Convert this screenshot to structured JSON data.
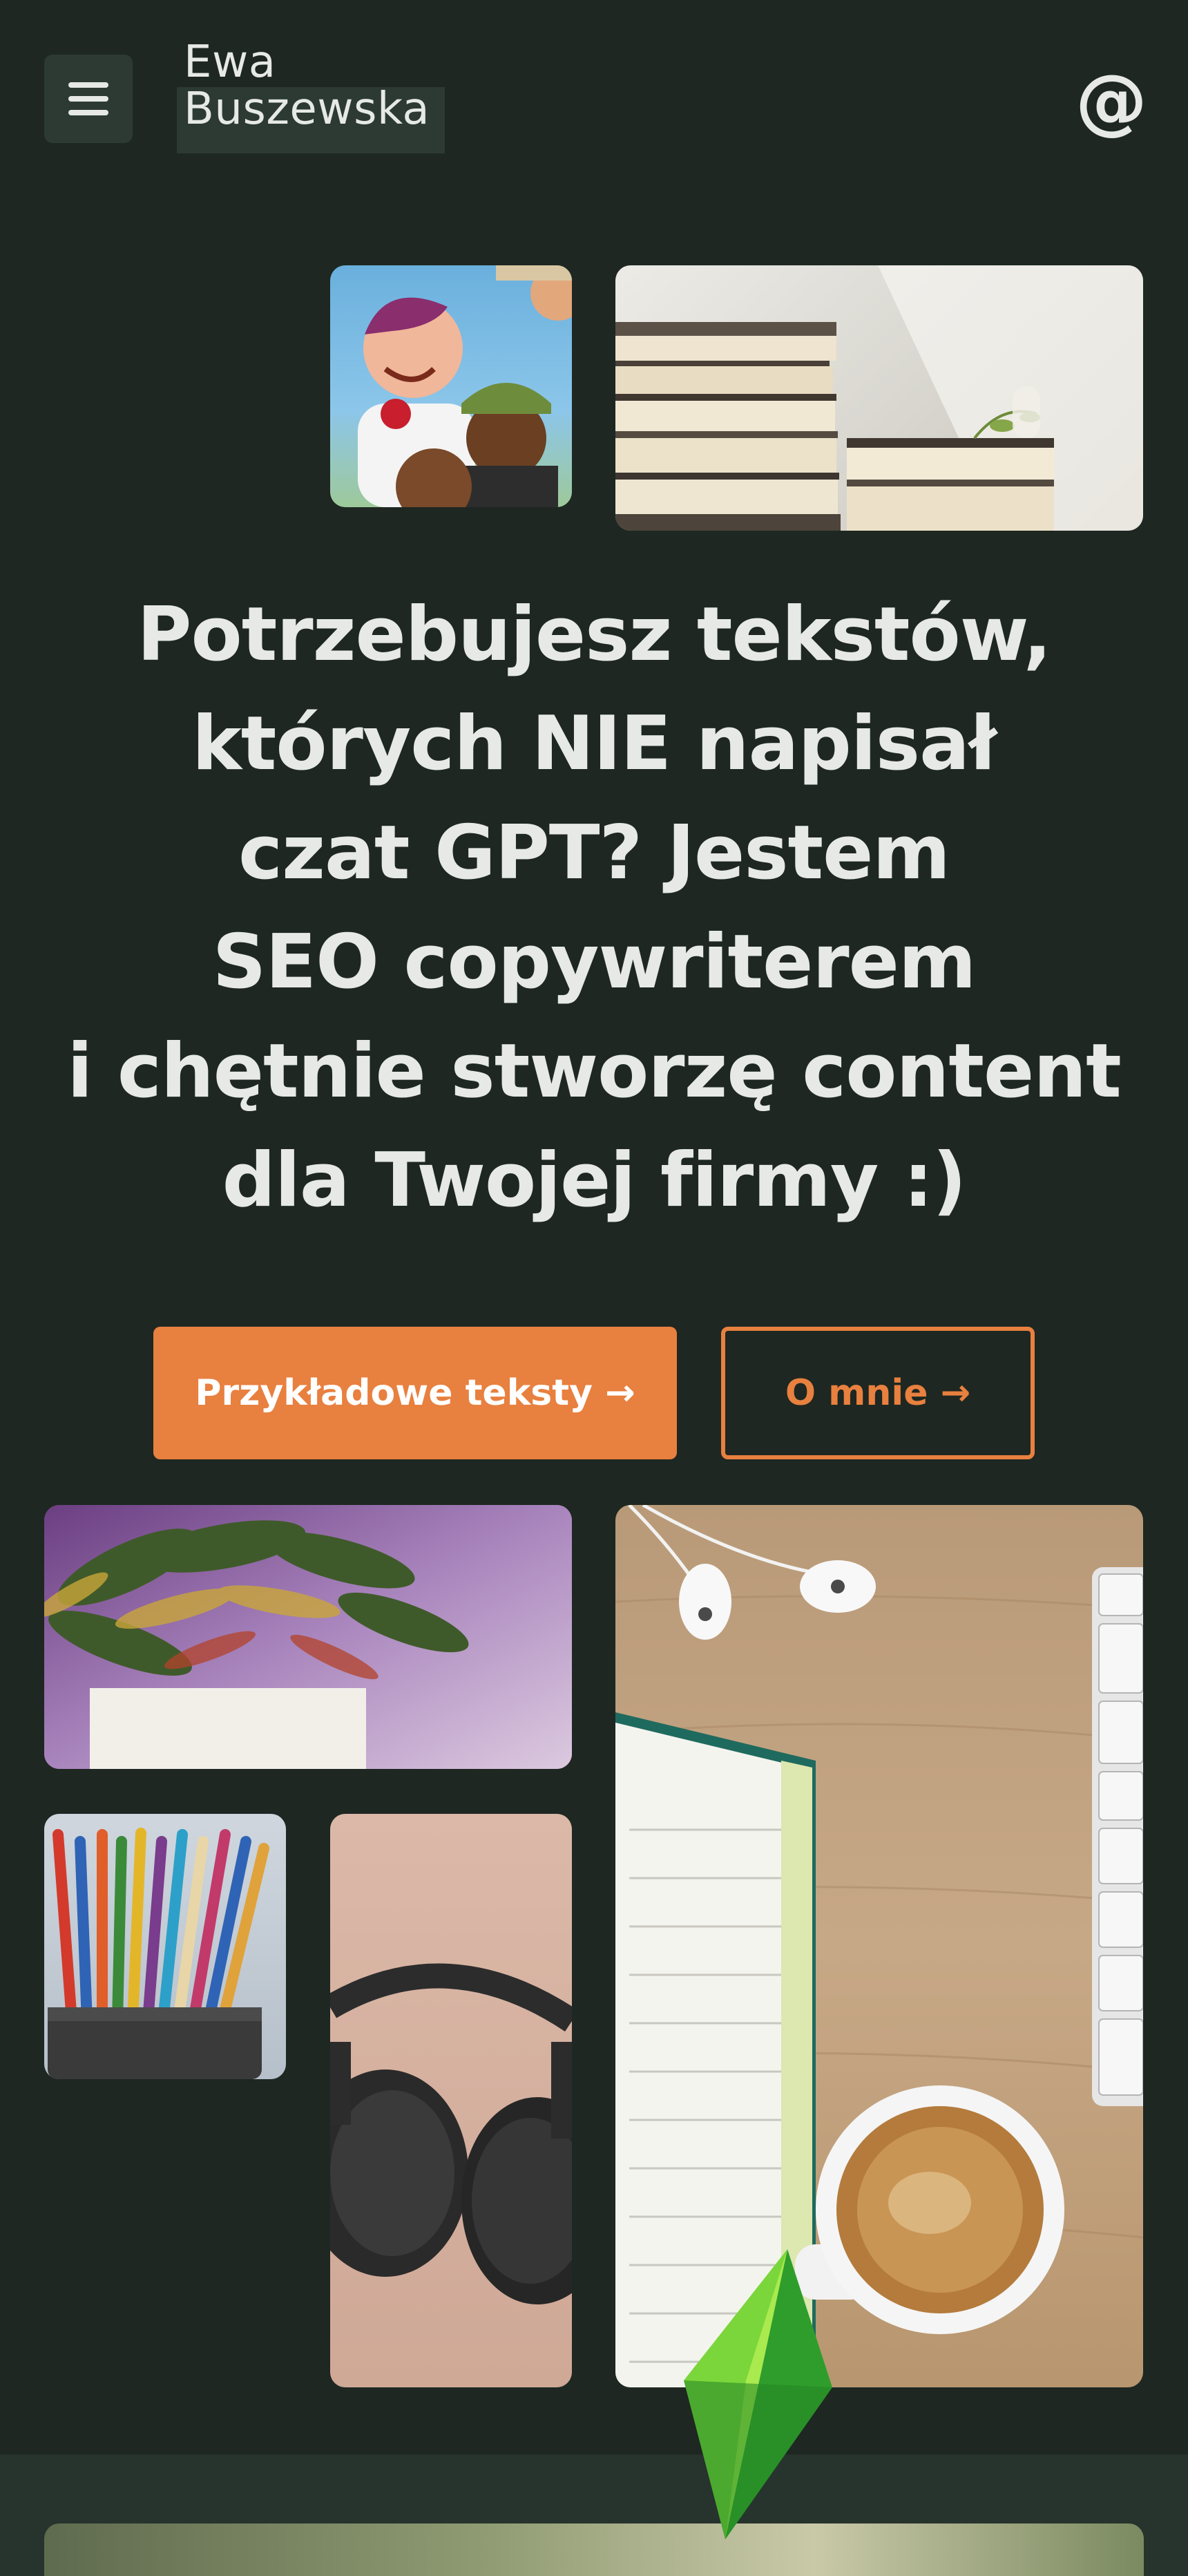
{
  "header": {
    "menu_icon": "hamburger-menu-icon",
    "logo_line1": "Ewa",
    "logo_line2": "Buszewska",
    "contact_glyph": "@"
  },
  "hero": {
    "headline_lines": [
      "Potrzebujesz tekstów,",
      "których NIE napisał",
      "czat GPT? Jestem",
      "SEO copywriterem",
      "i chętnie stworzę content",
      "dla Twojej firmy :)"
    ],
    "primary_button": "Przykładowe teksty →",
    "secondary_button": "O mnie →"
  },
  "images": {
    "top_left": "sims-characters-image",
    "top_right": "books-stack-image",
    "plant": "plant-image",
    "desk": "desk-notebook-coffee-image",
    "pencils": "colored-pencils-image",
    "headphones": "headphones-image",
    "decoration": "plumbob-icon"
  },
  "colors": {
    "background": "#1e2721",
    "accent": "#e8803f",
    "text": "#e6e9e6",
    "panel": "#2c3a33"
  }
}
